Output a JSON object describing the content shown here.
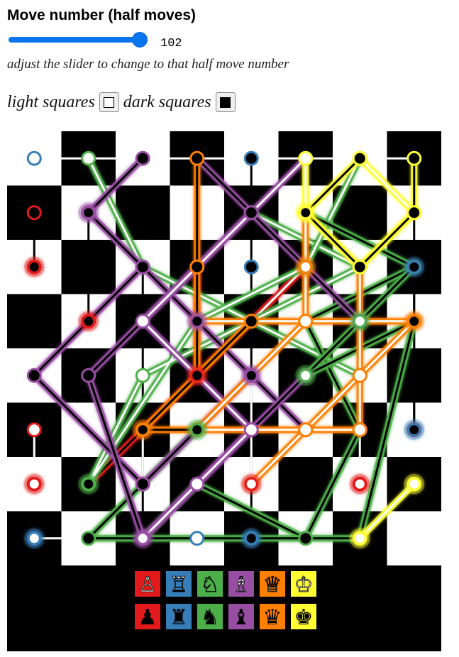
{
  "header": {
    "title": "Move number (half moves)"
  },
  "slider": {
    "value": "102",
    "fraction": 1.0
  },
  "hint": "adjust the slider to change to that half move number",
  "colors": {
    "light_label": "light squares",
    "dark_label": "dark squares",
    "light_color": "#ffffff",
    "dark_color": "#000000"
  },
  "piece_colors": {
    "pawn": "#e31a1c",
    "rook": "#377eb8",
    "knight": "#4daf4a",
    "bishop": "#984ea3",
    "queen": "#ff7f00",
    "king": "#ffff33"
  },
  "legend": {
    "white": [
      {
        "piece": "pawn",
        "icon": "white-pawn-icon",
        "glyph": "♙"
      },
      {
        "piece": "rook",
        "icon": "white-rook-icon",
        "glyph": "♖"
      },
      {
        "piece": "knight",
        "icon": "white-knight-icon",
        "glyph": "♘"
      },
      {
        "piece": "bishop",
        "icon": "white-bishop-icon",
        "glyph": "♗"
      },
      {
        "piece": "queen",
        "icon": "white-queen-icon",
        "glyph": "♕"
      },
      {
        "piece": "king",
        "icon": "white-king-icon",
        "glyph": "♔"
      }
    ],
    "black": [
      {
        "piece": "pawn",
        "icon": "black-pawn-icon",
        "glyph": "♟"
      },
      {
        "piece": "rook",
        "icon": "black-rook-icon",
        "glyph": "♜"
      },
      {
        "piece": "knight",
        "icon": "black-knight-icon",
        "glyph": "♞"
      },
      {
        "piece": "bishop",
        "icon": "black-bishop-icon",
        "glyph": "♝"
      },
      {
        "piece": "queen",
        "icon": "black-queen-icon",
        "glyph": "♛"
      },
      {
        "piece": "king",
        "icon": "black-king-icon",
        "glyph": "♚"
      }
    ]
  },
  "paths": [
    {
      "piece": "rook",
      "side": "white",
      "squares": [
        "a8",
        "h8"
      ]
    },
    {
      "piece": "rook",
      "side": "white",
      "squares": [
        "a1",
        "d1",
        "e1"
      ]
    },
    {
      "piece": "rook",
      "side": "black",
      "squares": [
        "e8",
        "e6",
        "e1"
      ]
    },
    {
      "piece": "rook",
      "side": "black",
      "squares": [
        "c6",
        "c1"
      ]
    },
    {
      "piece": "rook",
      "side": "black",
      "squares": [
        "h6",
        "h3"
      ]
    },
    {
      "piece": "pawn",
      "side": "black",
      "squares": [
        "a7",
        "a6"
      ]
    },
    {
      "piece": "pawn",
      "side": "black",
      "squares": [
        "b7",
        "b5"
      ]
    },
    {
      "piece": "pawn",
      "side": "black",
      "squares": [
        "d6",
        "d4",
        "b2"
      ]
    },
    {
      "piece": "pawn",
      "side": "black",
      "squares": [
        "h7",
        "h5",
        "h3"
      ]
    },
    {
      "piece": "pawn",
      "side": "white",
      "squares": [
        "a3",
        "a2"
      ]
    },
    {
      "piece": "pawn",
      "side": "white",
      "squares": [
        "d4",
        "f6"
      ]
    },
    {
      "piece": "pawn",
      "side": "white",
      "squares": [
        "e2",
        "e4"
      ]
    },
    {
      "piece": "pawn",
      "side": "white",
      "squares": [
        "g2",
        "g3"
      ]
    },
    {
      "piece": "pawn",
      "side": "white",
      "squares": [
        "c2",
        "c3"
      ]
    },
    {
      "piece": "knight",
      "side": "white",
      "squares": [
        "b8",
        "c6",
        "e5",
        "g6",
        "e7"
      ]
    },
    {
      "piece": "knight",
      "side": "white",
      "squares": [
        "g8",
        "f6",
        "d5",
        "b2",
        "c4",
        "e5",
        "g4"
      ]
    },
    {
      "piece": "knight",
      "side": "black",
      "squares": [
        "f7",
        "h6",
        "f5",
        "g3",
        "f1",
        "d2",
        "c1"
      ]
    },
    {
      "piece": "knight",
      "side": "black",
      "squares": [
        "d3",
        "b1",
        "g1",
        "h5",
        "f4",
        "h6",
        "g5"
      ]
    },
    {
      "piece": "bishop",
      "side": "black",
      "squares": [
        "c8",
        "b7",
        "e4",
        "c2",
        "a4",
        "c6",
        "f3"
      ]
    },
    {
      "piece": "bishop",
      "side": "black",
      "squares": [
        "d8",
        "g5",
        "e7",
        "b4",
        "c1",
        "f4"
      ]
    },
    {
      "piece": "bishop",
      "side": "white",
      "squares": [
        "f8",
        "c5",
        "e3",
        "c1",
        "d2"
      ]
    },
    {
      "piece": "queen",
      "side": "white",
      "squares": [
        "f7",
        "f5",
        "h5",
        "f3",
        "e2",
        "h5",
        "d5"
      ]
    },
    {
      "piece": "queen",
      "side": "white",
      "squares": [
        "g6",
        "g4",
        "g3",
        "d3",
        "f5"
      ]
    },
    {
      "piece": "queen",
      "side": "black",
      "squares": [
        "d8",
        "d6",
        "d4",
        "e5",
        "c3",
        "d3"
      ]
    },
    {
      "piece": "king",
      "side": "white",
      "squares": [
        "g8",
        "h7",
        "g6",
        "f7",
        "f8"
      ]
    },
    {
      "piece": "king",
      "side": "white",
      "squares": [
        "h2",
        "g1"
      ]
    },
    {
      "piece": "king",
      "side": "black",
      "squares": [
        "h8",
        "h7",
        "g6",
        "f7",
        "g8"
      ]
    }
  ],
  "final_positions": [
    {
      "piece": "rook",
      "side": "black",
      "square": "h3"
    },
    {
      "piece": "rook",
      "side": "white",
      "square": "a1"
    },
    {
      "piece": "rook",
      "side": "black",
      "square": "e1"
    },
    {
      "piece": "rook",
      "side": "black",
      "square": "h6"
    },
    {
      "piece": "pawn",
      "side": "black",
      "square": "b5"
    },
    {
      "piece": "pawn",
      "side": "black",
      "square": "a6"
    },
    {
      "piece": "pawn",
      "side": "black",
      "square": "d4"
    },
    {
      "piece": "pawn",
      "side": "white",
      "square": "a2"
    },
    {
      "piece": "pawn",
      "side": "white",
      "square": "e2"
    },
    {
      "piece": "pawn",
      "side": "white",
      "square": "g2"
    },
    {
      "piece": "knight",
      "side": "black",
      "square": "b2"
    },
    {
      "piece": "knight",
      "side": "black",
      "square": "d3"
    },
    {
      "piece": "knight",
      "side": "white",
      "square": "f4"
    },
    {
      "piece": "knight",
      "side": "white",
      "square": "g5"
    },
    {
      "piece": "bishop",
      "side": "black",
      "square": "b7"
    },
    {
      "piece": "bishop",
      "side": "black",
      "square": "d5"
    },
    {
      "piece": "bishop",
      "side": "black",
      "square": "e4"
    },
    {
      "piece": "bishop",
      "side": "white",
      "square": "c1"
    },
    {
      "piece": "queen",
      "side": "black",
      "square": "c3"
    },
    {
      "piece": "queen",
      "side": "white",
      "square": "f6"
    },
    {
      "piece": "queen",
      "side": "black",
      "square": "h5"
    },
    {
      "piece": "king",
      "side": "black",
      "square": "f7"
    },
    {
      "piece": "king",
      "side": "white",
      "square": "h2"
    },
    {
      "piece": "king",
      "side": "white",
      "square": "g1"
    }
  ]
}
